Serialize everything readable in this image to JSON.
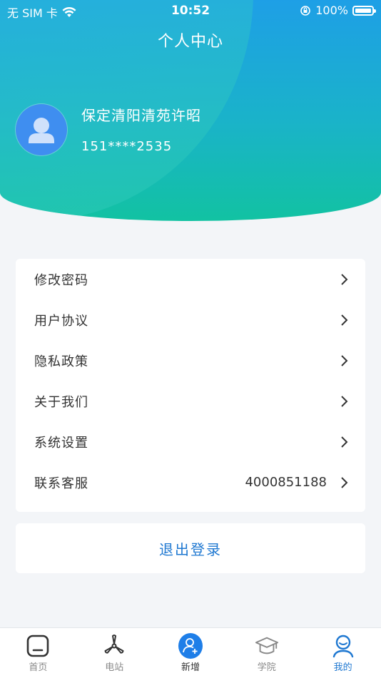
{
  "status_bar": {
    "carrier": "无 SIM 卡",
    "time": "10:52",
    "battery": "100%"
  },
  "header": {
    "title": "个人中心"
  },
  "profile": {
    "name": "保定清阳清苑许昭",
    "phone": "151****2535"
  },
  "menu": {
    "items": [
      {
        "label": "修改密码"
      },
      {
        "label": "用户协议"
      },
      {
        "label": "隐私政策"
      },
      {
        "label": "关于我们"
      },
      {
        "label": "系统设置"
      },
      {
        "label": "联系客服",
        "value": "4000851188"
      }
    ]
  },
  "logout": {
    "label": "退出登录"
  },
  "tabbar": {
    "tabs": [
      {
        "label": "首页",
        "icon": "home-icon"
      },
      {
        "label": "电站",
        "icon": "wind-turbine-icon"
      },
      {
        "label": "新增",
        "icon": "add-user-icon"
      },
      {
        "label": "学院",
        "icon": "graduation-cap-icon"
      },
      {
        "label": "我的",
        "icon": "user-icon"
      }
    ],
    "active_tab": "我的"
  },
  "colors": {
    "accent": "#1f78d1",
    "header_top": "#1e9fe6",
    "header_bottom": "#12c2a2",
    "background": "#f3f5f8"
  }
}
